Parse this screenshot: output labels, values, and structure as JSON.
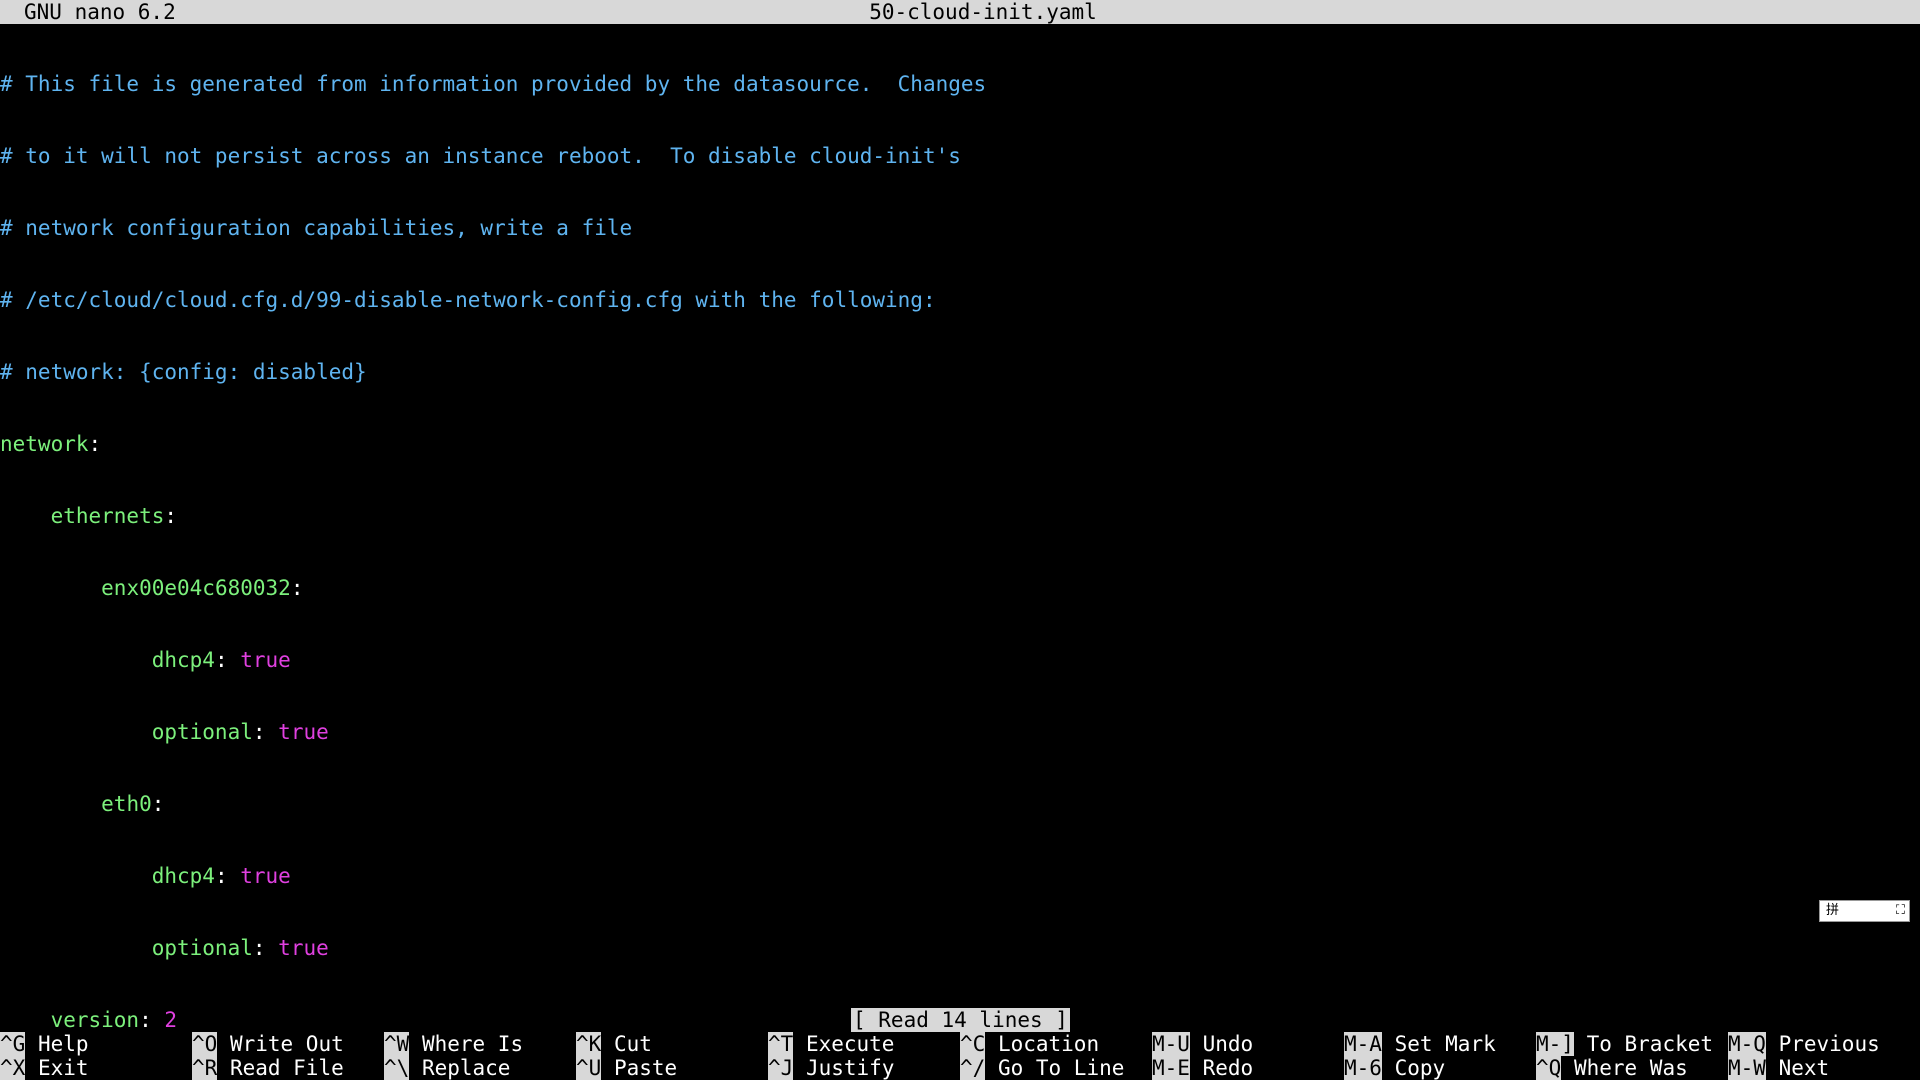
{
  "titlebar": {
    "app": "GNU nano 6.2",
    "file": "50-cloud-init.yaml"
  },
  "editor": {
    "comments": [
      "# This file is generated from information provided by the datasource.  Changes",
      "# to it will not persist across an instance reboot.  To disable cloud-init's",
      "# network configuration capabilities, write a file",
      "# /etc/cloud/cloud.cfg.d/99-disable-network-config.cfg with the following:",
      "# network: {config: disabled}"
    ],
    "network_key": "network",
    "ethernets_key": "ethernets",
    "iface1": "enx00e04c680032",
    "iface2": "eth0",
    "dhcp4_key": "dhcp4",
    "optional_key": "optional",
    "true_val": "true",
    "version_key": "version",
    "version_val": "2"
  },
  "status": "[ Read 14 lines ]",
  "shortcuts": [
    {
      "key": "^G",
      "label": "Help"
    },
    {
      "key": "^X",
      "label": "Exit"
    },
    {
      "key": "^O",
      "label": "Write Out"
    },
    {
      "key": "^R",
      "label": "Read File"
    },
    {
      "key": "^W",
      "label": "Where Is"
    },
    {
      "key": "^\\",
      "label": "Replace"
    },
    {
      "key": "^K",
      "label": "Cut"
    },
    {
      "key": "^U",
      "label": "Paste"
    },
    {
      "key": "^T",
      "label": "Execute"
    },
    {
      "key": "^J",
      "label": "Justify"
    },
    {
      "key": "^C",
      "label": "Location"
    },
    {
      "key": "^/",
      "label": "Go To Line"
    },
    {
      "key": "M-U",
      "label": "Undo"
    },
    {
      "key": "M-E",
      "label": "Redo"
    },
    {
      "key": "M-A",
      "label": "Set Mark"
    },
    {
      "key": "M-6",
      "label": "Copy"
    },
    {
      "key": "M-]",
      "label": "To Bracket"
    },
    {
      "key": "^Q",
      "label": "Where Was"
    },
    {
      "key": "M-Q",
      "label": "Previous"
    },
    {
      "key": "M-W",
      "label": "Next"
    }
  ],
  "ime": {
    "grid_glyph": "拼",
    "expand_glyph": "⛶"
  }
}
